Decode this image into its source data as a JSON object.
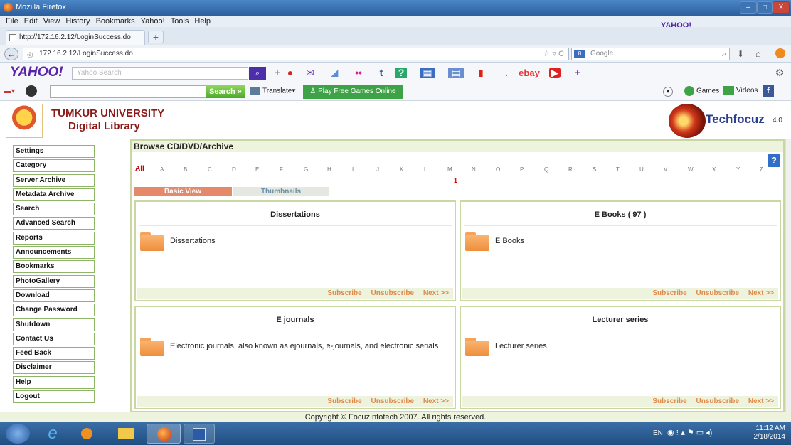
{
  "window": {
    "title": "Mozilla Firefox",
    "minimize": "–",
    "maximize": "□",
    "close": "X"
  },
  "menu": [
    "File",
    "Edit",
    "View",
    "History",
    "Bookmarks",
    "Yahoo!",
    "Tools",
    "Help"
  ],
  "menu_brand": "YAHOO!",
  "tab": {
    "label": "http://172.16.2.12/LoginSuccess.do",
    "new_tab": "+"
  },
  "nav": {
    "url": "172.16.2.12/LoginSuccess.do",
    "search_placeholder": "Google"
  },
  "yahoo_toolbar": {
    "logo": "YAHOO!",
    "search_placeholder": "Yahoo Search",
    "ebay": "ebay"
  },
  "google_toolbar": {
    "search_button": "Search",
    "translate": "Translate",
    "play": "Play Free Games Online",
    "games": "Games",
    "videos": "Videos"
  },
  "header": {
    "university": "TUMKUR UNIVERSITY",
    "library": "Digital Library",
    "vendor": "Techfocuz",
    "version": "4.0"
  },
  "sidebar": {
    "items": [
      "Settings",
      "Category",
      "Server Archive",
      "Metadata Archive",
      "Search",
      "Advanced Search",
      "Reports",
      "Announcements",
      "Bookmarks",
      "PhotoGallery",
      "Download",
      "Change Password",
      "Shutdown",
      "Contact Us",
      "Feed Back",
      "Disclaimer",
      "Help",
      "Logout"
    ]
  },
  "main": {
    "heading": "Browse CD/DVD/Archive",
    "help": "?",
    "alphabet": [
      "All",
      "A",
      "B",
      "C",
      "D",
      "E",
      "F",
      "G",
      "H",
      "I",
      "J",
      "K",
      "L",
      "M",
      "N",
      "O",
      "P",
      "Q",
      "R",
      "S",
      "T",
      "U",
      "V",
      "W",
      "X",
      "Y",
      "Z"
    ],
    "m_count": "1",
    "views": {
      "basic": "Basic View",
      "thumbnails": "Thumbnails"
    },
    "panels": [
      {
        "title": "Dissertations",
        "desc": "Dissertations"
      },
      {
        "title": "E Books ( 97 )",
        "desc": "E Books"
      },
      {
        "title": "E journals",
        "desc": "Electronic journals, also known as ejournals, e-journals, and electronic serials"
      },
      {
        "title": "Lecturer series",
        "desc": "Lecturer series"
      }
    ],
    "footer": {
      "subscribe": "Subscribe",
      "unsubscribe": "Unsubscribe",
      "next": "Next >>"
    }
  },
  "copyright": "Copyright © FocuzInfotech 2007. All rights reserved.",
  "taskbar": {
    "lang": "EN",
    "time": "11:12 AM",
    "date": "2/18/2014"
  },
  "colors": {
    "accent_green": "#c9d8a2",
    "maroon": "#8b1a1a",
    "link_orange": "#e08a4a",
    "basic_view": "#e48a6a"
  }
}
